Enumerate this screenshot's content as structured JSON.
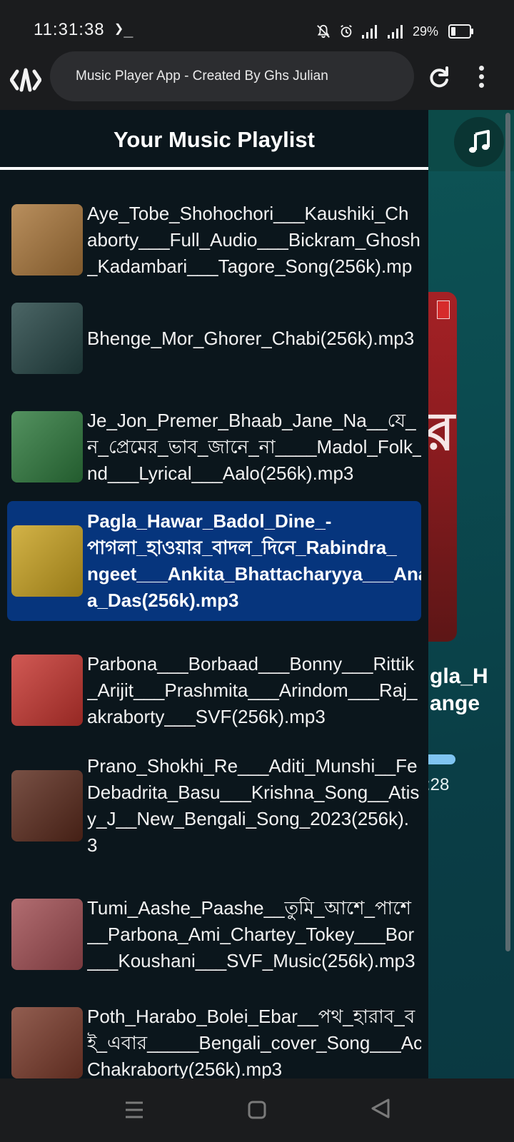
{
  "status_bar": {
    "time": "11:31:38",
    "prompt": "❯_",
    "battery": "29%",
    "icons": [
      "mute-bell-icon",
      "alarm-icon",
      "signal-icon",
      "signal-icon",
      "battery-icon"
    ]
  },
  "browser": {
    "url_title": "Music Player App - Created By Ghs Julian",
    "logo_icon": "app-logo-icon",
    "reload_icon": "reload-icon",
    "menu_icon": "kebab-menu-icon"
  },
  "background_player": {
    "now_playing_title_line1": "gla_H",
    "now_playing_title_line2": "ange",
    "cover_glyph": "র",
    "current_time": ":28",
    "fab_icon": "music-note-icon",
    "progress_fraction": 0.3
  },
  "playlist": {
    "heading": "Your Music Playlist",
    "items": [
      {
        "name": "Aye_Tobe_Shohochori___Kaushiki_Ch\naborty___Full_Audio___Bickram_Ghosh\n_Kadambari___Tagore_Song(256k).mp",
        "thumb": "#a9763a",
        "active": false
      },
      {
        "name": "Bhenge_Mor_Ghorer_Chabi(256k).mp3",
        "thumb": "#244444",
        "active": false
      },
      {
        "name": "Je_Jon_Premer_Bhaab_Jane_Na__যে_\nন_প্রেমের_ভাব_জানে_না____Madol_Folk_\nnd___Lyrical___Aalo(256k).mp3",
        "thumb": "#2e7a3d",
        "active": false
      },
      {
        "name": "Pagla_Hawar_Badol_Dine_-\nপাগলা_হাওয়ার_বাদল_দিনে_Rabindra_\nngeet___Ankita_Bhattacharyya___Ana\na_Das(256k).mp3",
        "thumb": "#c9a21f",
        "active": true
      },
      {
        "name": "Parbona___Borbaad___Bonny___Rittik\n_Arijit___Prashmita___Arindom___Raj_\nakraborty___SVF(256k).mp3",
        "thumb": "#c7352f",
        "active": false
      },
      {
        "name": "Prano_Shokhi_Re___Aditi_Munshi__Fe\nDebadrita_Basu___Krishna_Song__Atis\ny_J__New_Bengali_Song_2023(256k).\n3",
        "thumb": "#5b2a1c",
        "active": false
      },
      {
        "name": "Tumi_Aashe_Paashe__তুমি_আশে_পাশে\n__Parbona_Ami_Chartey_Tokey___Bor\n___Koushani___SVF_Music(256k).mp3",
        "thumb": "#a14d52",
        "active": false
      },
      {
        "name": "Poth_Harabo_Bolei_Ebar__পথ_হারাব_ব\nই_এবার_____Bengali_cover_Song___Ac\nChakraborty(256k).mp3",
        "thumb": "#7a3a2a",
        "active": false
      }
    ]
  },
  "nav_bar": {
    "icons": [
      "recents-icon",
      "home-icon",
      "back-icon"
    ]
  }
}
